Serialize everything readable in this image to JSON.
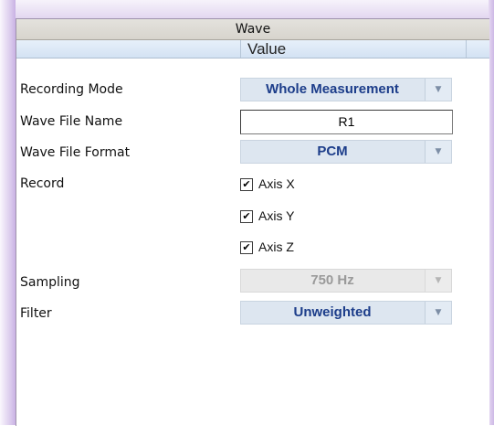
{
  "panel": {
    "title": "Wave",
    "value_header": "Value"
  },
  "rows": {
    "recording_mode": {
      "label": "Recording Mode",
      "value": "Whole Measurement"
    },
    "wave_file_name": {
      "label": "Wave File Name",
      "value": "R1"
    },
    "wave_file_format": {
      "label": "Wave File Format",
      "value": "PCM"
    },
    "record": {
      "label": "Record",
      "options": [
        {
          "label": "Axis X",
          "checked": true
        },
        {
          "label": "Axis Y",
          "checked": true
        },
        {
          "label": "Axis Z",
          "checked": true
        }
      ]
    },
    "sampling": {
      "label": "Sampling",
      "value": "750 Hz",
      "disabled": true
    },
    "filter": {
      "label": "Filter",
      "value": "Unweighted"
    }
  },
  "icons": {
    "dropdown_arrow": "chevron-down-icon",
    "checkmark": "checkmark-icon"
  },
  "colors": {
    "dropdown_text": "#1c3d8a",
    "dropdown_bg": "#dde6f0",
    "disabled_text": "#9a9a9a",
    "header_bg": "#d3e2f3"
  },
  "glyphs": {
    "arrow": "▼",
    "check": "✔"
  }
}
